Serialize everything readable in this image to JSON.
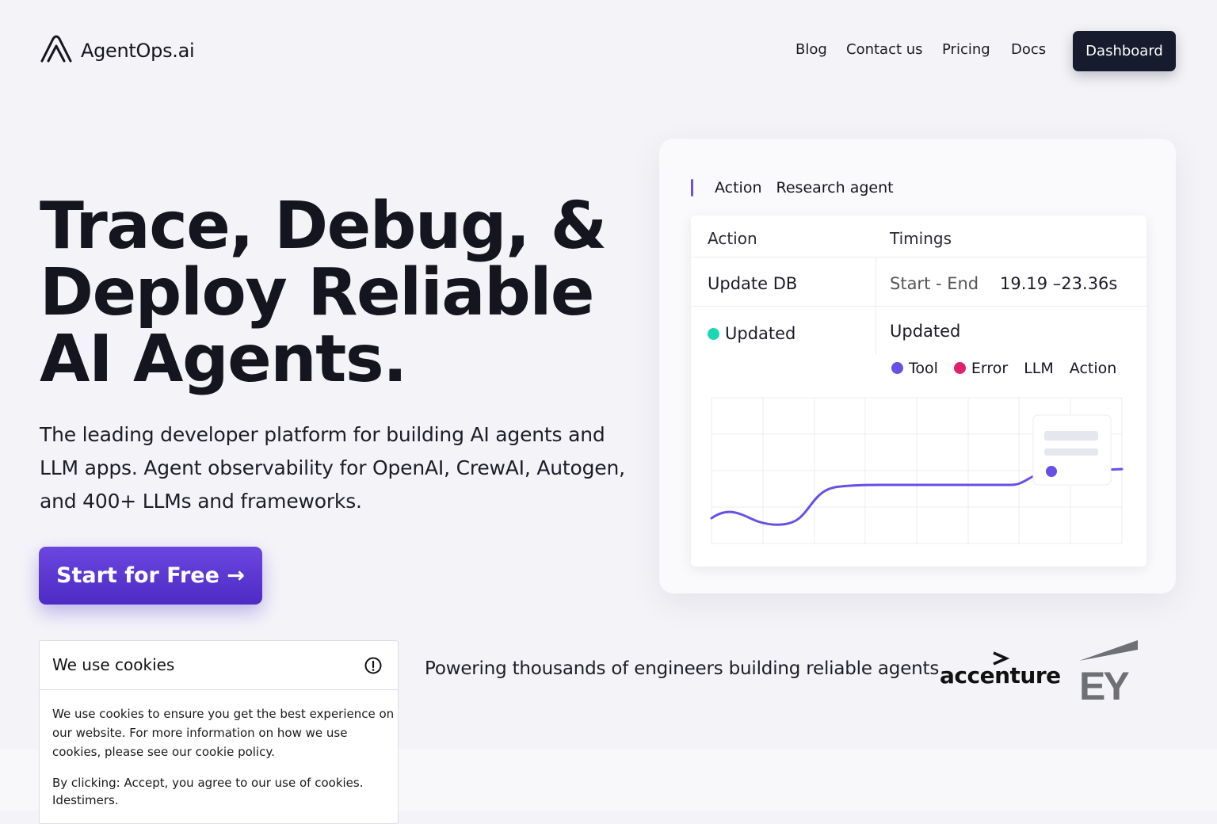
{
  "brand": {
    "name": "AgentOps.ai"
  },
  "nav": {
    "blog": "Blog",
    "contact": "Contact us",
    "pricing": "Pricing",
    "docs": "Docs",
    "dashboard": "Dashboard"
  },
  "hero": {
    "title_lines": [
      "Trace, Debug, &",
      "Deploy Reliable",
      "AI Agents."
    ],
    "subtitle": "The leading developer platform for building AI agents and LLM apps. Agent observability for OpenAI, CrewAI, Autogen, and 400+ LLMs and frameworks.",
    "cta": "Start for Free →"
  },
  "trace_card": {
    "header_label": "Action",
    "header_value": "Research agent",
    "col_action": "Action",
    "col_timings": "Timings",
    "row_action": "Update DB",
    "timing_label": "Start - End",
    "timing_value": "19.19 –23.36s",
    "status_left": "Updated",
    "status_right": "Updated",
    "legend": {
      "tool": "Tool",
      "error": "Error",
      "llm": "LLM",
      "action": "Action"
    },
    "colors": {
      "accent": "#6a4fe6",
      "updated": "#1fd6b4",
      "tool": "#6a4fe6",
      "error": "#e0206a"
    }
  },
  "cookie": {
    "title": "We use cookies",
    "body": "We use cookies to ensure you get the best experience on our website. For more information on how we use cookies, please see our cookie policy.",
    "consent": "By clicking: Accept, you agree to our use of cookies. Idestimers."
  },
  "social_proof": {
    "text": "Powering thousands of engineers building reliable agents",
    "logos": [
      "accenture",
      "EY"
    ]
  }
}
